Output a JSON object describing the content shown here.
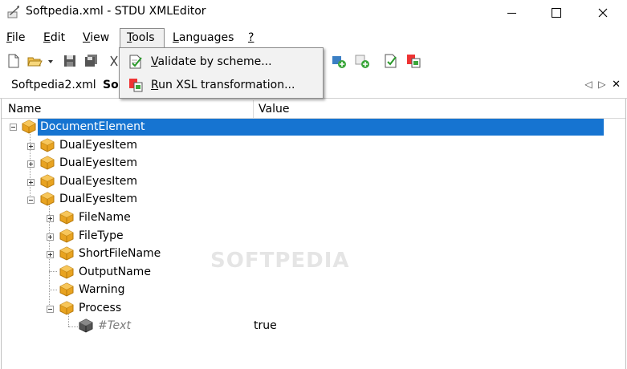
{
  "window": {
    "title": "Softpedia.xml - STDU XMLEditor"
  },
  "menu": {
    "items": [
      {
        "label": "File",
        "underline": "F",
        "rest": "ile"
      },
      {
        "label": "Edit",
        "underline": "E",
        "rest": "dit"
      },
      {
        "label": "View",
        "underline": "V",
        "rest": "iew"
      },
      {
        "label": "Tools",
        "underline": "T",
        "rest": "ools"
      },
      {
        "label": "Languages",
        "underline": "L",
        "rest": "anguages"
      },
      {
        "label": "?",
        "underline": "?",
        "rest": ""
      }
    ]
  },
  "tools_menu": {
    "items": [
      {
        "label": "Validate by scheme...",
        "underline": "V",
        "rest": "alidate by scheme...",
        "icon": "validate-icon"
      },
      {
        "label": "Run XSL transformation...",
        "underline": "R",
        "rest": "un XSL transformation...",
        "icon": "xsl-transform-icon"
      }
    ]
  },
  "tabs": [
    {
      "label": "Softpedia2.xml"
    },
    {
      "label": "So",
      "active": true
    }
  ],
  "tab_nav": {
    "prev": "◁",
    "next": "▷",
    "close": "✕"
  },
  "tree": {
    "columns": {
      "name": "Name",
      "value": "Value"
    },
    "nodes": [
      {
        "label": "DocumentElement",
        "value": ""
      },
      {
        "label": "DualEyesItem",
        "value": ""
      },
      {
        "label": "DualEyesItem",
        "value": ""
      },
      {
        "label": "DualEyesItem",
        "value": ""
      },
      {
        "label": "DualEyesItem",
        "value": ""
      },
      {
        "label": "FileName",
        "value": ""
      },
      {
        "label": "FileType",
        "value": ""
      },
      {
        "label": "ShortFileName",
        "value": ""
      },
      {
        "label": "OutputName",
        "value": ""
      },
      {
        "label": "Warning",
        "value": ""
      },
      {
        "label": "Process",
        "value": ""
      },
      {
        "label": "#Text",
        "value": "true"
      }
    ]
  },
  "watermark": "SOFTPEDIA",
  "colors": {
    "selection": "#1674d1",
    "node_text": "#000000",
    "text_node": "#7a7a7a",
    "package_icon": "#e8a320"
  }
}
